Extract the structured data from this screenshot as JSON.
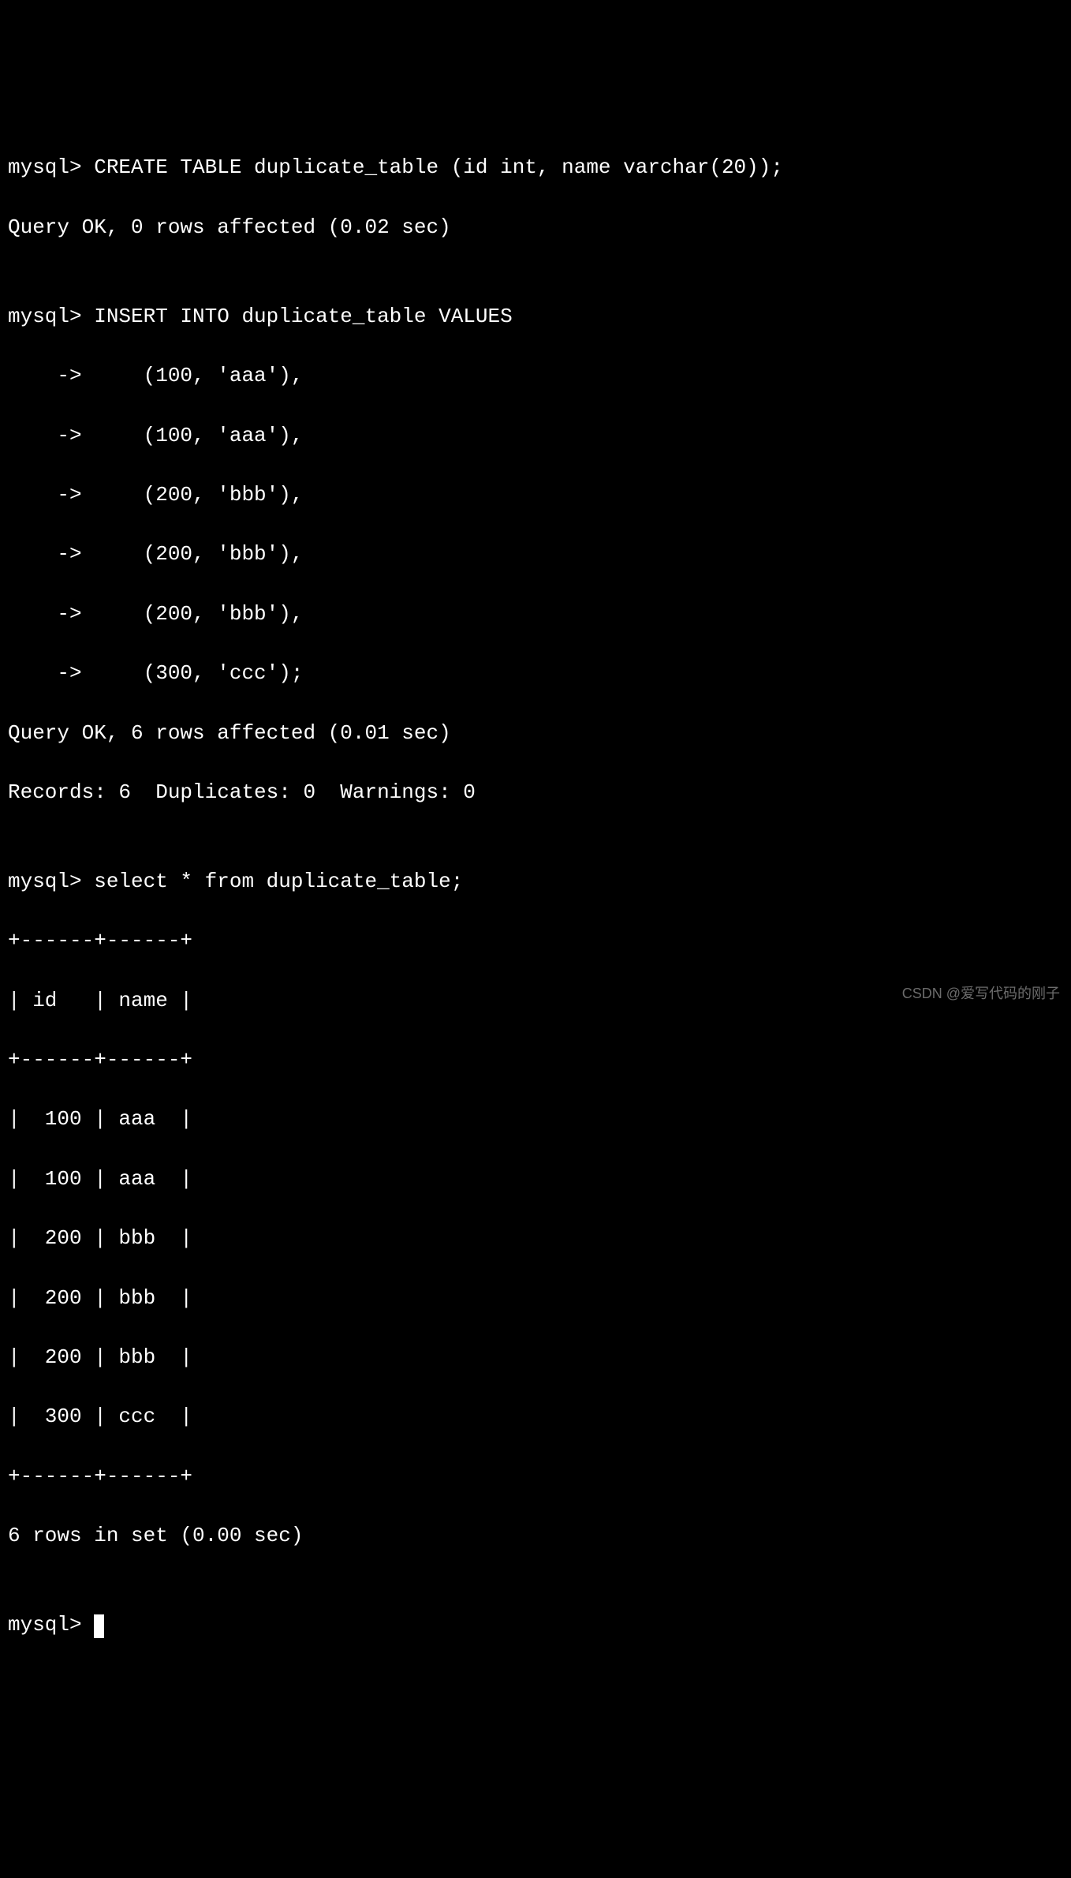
{
  "prompt_main": "mysql> ",
  "prompt_cont": "    -> ",
  "lines": {
    "l0": "mysql> CREATE TABLE duplicate_table (id int, name varchar(20));",
    "l1": "Query OK, 0 rows affected (0.02 sec)",
    "l2": "",
    "l3": "mysql> INSERT INTO duplicate_table VALUES",
    "l4": "    ->     (100, 'aaa'),",
    "l5": "    ->     (100, 'aaa'),",
    "l6": "    ->     (200, 'bbb'),",
    "l7": "    ->     (200, 'bbb'),",
    "l8": "    ->     (200, 'bbb'),",
    "l9": "    ->     (300, 'ccc');",
    "l10": "Query OK, 6 rows affected (0.01 sec)",
    "l11": "Records: 6  Duplicates: 0  Warnings: 0",
    "l12": "",
    "l13": "mysql> select * from duplicate_table;",
    "l14": "+------+------+",
    "l15": "| id   | name |",
    "l16": "+------+------+",
    "l17": "|  100 | aaa  |",
    "l18": "|  100 | aaa  |",
    "l19": "|  200 | bbb  |",
    "l20": "|  200 | bbb  |",
    "l21": "|  200 | bbb  |",
    "l22": "|  300 | ccc  |",
    "l23": "+------+------+",
    "l24": "6 rows in set (0.00 sec)",
    "l25": "",
    "l26": "mysql> "
  },
  "table_result": {
    "headers": [
      "id",
      "name"
    ],
    "rows": [
      [
        100,
        "aaa"
      ],
      [
        100,
        "aaa"
      ],
      [
        200,
        "bbb"
      ],
      [
        200,
        "bbb"
      ],
      [
        200,
        "bbb"
      ],
      [
        300,
        "ccc"
      ]
    ],
    "row_count": 6,
    "time_sec": "0.00"
  },
  "watermark": "CSDN @爱写代码的刚子"
}
